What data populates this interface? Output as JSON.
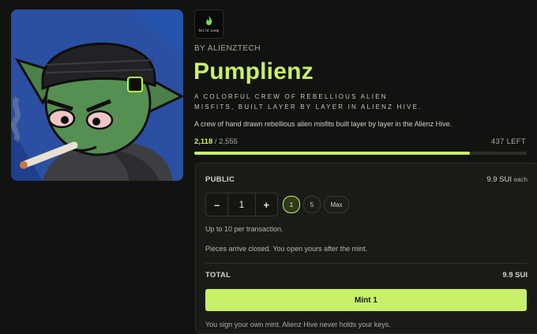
{
  "collection": {
    "logo_text": "build.pump",
    "by_line": "BY ALIENZTECH",
    "title": "Pumplienz",
    "tagline": "A COLORFUL CREW OF REBELLIOUS ALIEN MISFITS, BUILT LAYER BY LAYER IN ALIENZ HIVE.",
    "description": "A crew of hand drawn rebellious alien misfits built layer by layer in the Alienz Hive."
  },
  "progress": {
    "minted": "2,118",
    "supply": " / 2,555",
    "left": "437 LEFT",
    "fraction": 0.829
  },
  "mint": {
    "phase": "PUBLIC",
    "price": "9.9 SUI",
    "price_unit": "each",
    "quantity": "1",
    "decrement_label": "–",
    "increment_label": "+",
    "presets": [
      "1",
      "5",
      "Max"
    ],
    "selected_preset": "1",
    "limit_note": "Up to 10 per transaction.",
    "reveal_note": "Pieces arrive closed. You open yours after the mint.",
    "total_label": "TOTAL",
    "total_value": "9.9 SUI",
    "button_label": "Mint 1",
    "footer_note": "You sign your own mint. Alienz Hive never holds your keys."
  },
  "colors": {
    "accent": "#c8ef6a",
    "background": "#111310",
    "card": "#191c16"
  }
}
